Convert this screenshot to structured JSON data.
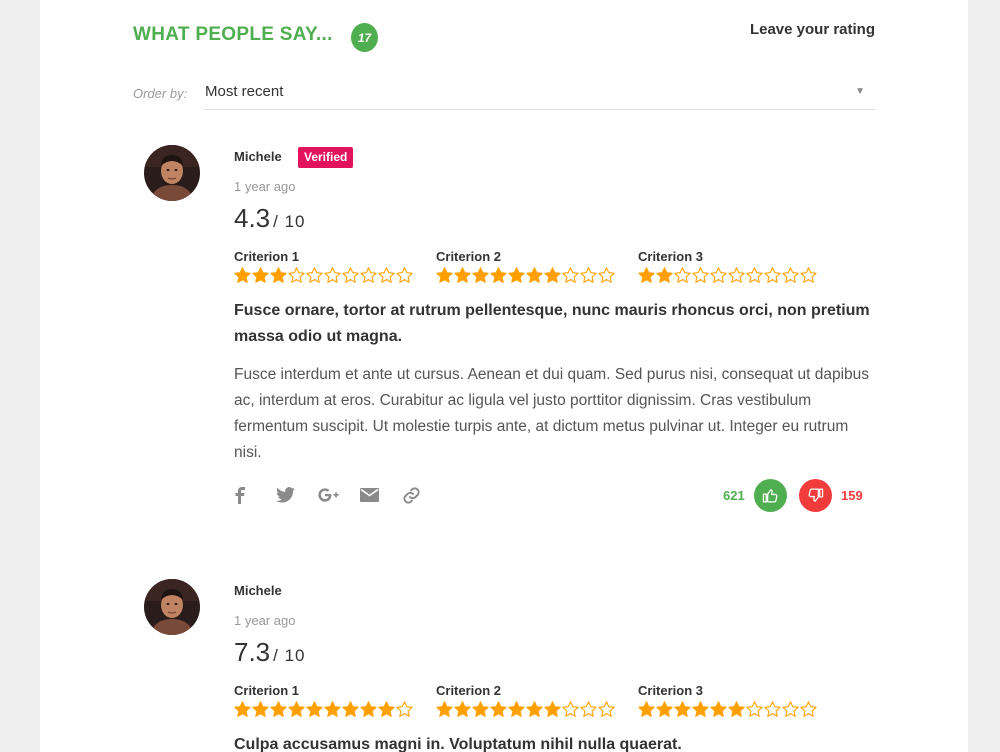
{
  "header": {
    "title": "WHAT PEOPLE SAY...",
    "count": "17",
    "leave_rating": "Leave your rating"
  },
  "order": {
    "label": "Order by:",
    "value": "Most recent"
  },
  "colors": {
    "accent": "#4fae4f",
    "verified": "#e3135b",
    "star": "#ffa000",
    "dislike": "#f23b3b"
  },
  "reviews": [
    {
      "author": "Michele",
      "verified": "Verified",
      "time": "1 year ago",
      "score": "4.3",
      "score_max": "/ 10",
      "criteria": [
        {
          "name": "Criterion 1",
          "stars": 3,
          "max": 10
        },
        {
          "name": "Criterion 2",
          "stars": 7,
          "max": 10
        },
        {
          "name": "Criterion 3",
          "stars": 2,
          "max": 10
        }
      ],
      "title": "Fusce ornare, tortor at rutrum pellentesque, nunc mauris rhoncus orci, non pretium massa odio ut magna.",
      "body": "Fusce interdum et ante ut cursus. Aenean et dui quam. Sed purus nisi, consequat ut dapibus ac, interdum at eros. Curabitur ac ligula vel justo porttitor dignissim. Cras vestibulum fermentum suscipit. Ut molestie turpis ante, at dictum metus pulvinar ut. Integer eu rutrum nisi.",
      "share_icons": [
        "facebook-icon",
        "twitter-icon",
        "google-plus-icon",
        "email-icon",
        "link-icon"
      ],
      "likes": "621",
      "dislikes": "159"
    },
    {
      "author": "Michele",
      "time": "1 year ago",
      "score": "7.3",
      "score_max": "/ 10",
      "criteria": [
        {
          "name": "Criterion 1",
          "stars": 9,
          "max": 10
        },
        {
          "name": "Criterion 2",
          "stars": 7,
          "max": 10
        },
        {
          "name": "Criterion 3",
          "stars": 6,
          "max": 10
        }
      ],
      "title": "Culpa accusamus magni in. Voluptatum nihil nulla quaerat."
    }
  ]
}
